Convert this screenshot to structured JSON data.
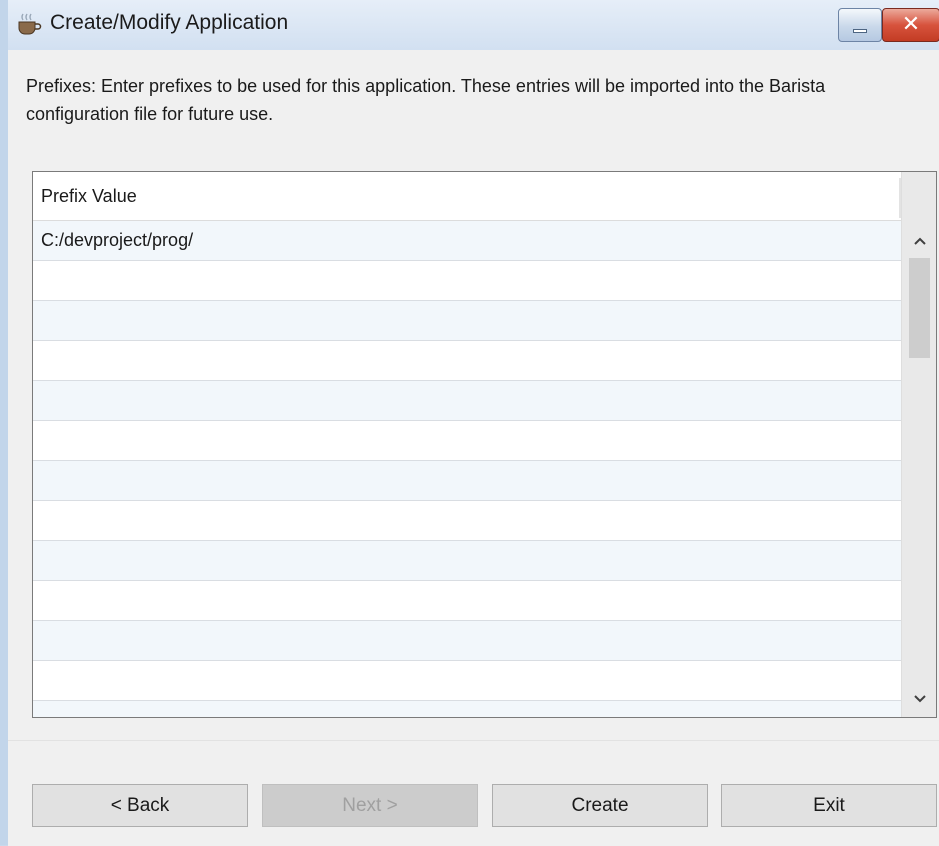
{
  "window": {
    "title": "Create/Modify Application",
    "close_label": "✕"
  },
  "description": "Prefixes: Enter prefixes to be used for this application.  These entries will be imported into the Barista configuration file for future use.",
  "grid": {
    "column_header": "Prefix Value",
    "rows": [
      "C:/devproject/prog/",
      "",
      "",
      "",
      "",
      "",
      "",
      "",
      "",
      "",
      "",
      "",
      ""
    ],
    "scroll_up_icon": "chevron-up-icon",
    "scroll_down_icon": "chevron-down-icon"
  },
  "buttons": {
    "back": "< Back",
    "next": "Next >",
    "create": "Create",
    "exit": "Exit"
  },
  "colors": {
    "title_bar": "#d2e0f1",
    "close_button": "#c33c24",
    "row_alt": "#f2f7fb"
  }
}
